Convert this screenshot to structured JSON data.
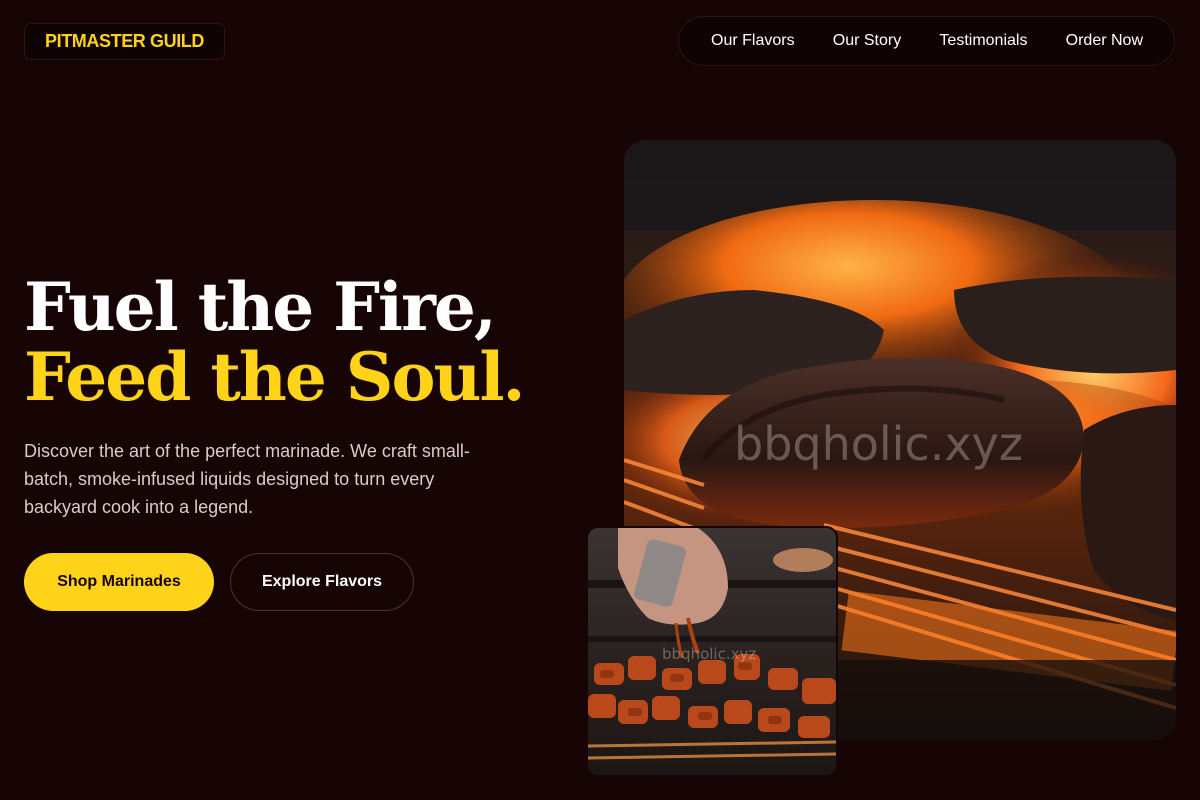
{
  "brand": {
    "logo_text": "PITMASTER GUILD",
    "accent_color": "#ffd31a",
    "background_color": "#170404"
  },
  "nav": {
    "items": [
      {
        "label": "Our Flavors"
      },
      {
        "label": "Our Story"
      },
      {
        "label": "Testimonials"
      },
      {
        "label": "Order Now"
      }
    ]
  },
  "hero": {
    "headline_line1": "Fuel the Fire,",
    "headline_line2": "Feed the Soul.",
    "subtext": "Discover the art of the perfect marinade. We craft small-batch, smoke-infused liquids designed to turn every backyard cook into a legend.",
    "primary_button": "Shop Marinades",
    "secondary_button": "Explore Flavors"
  },
  "images": {
    "main_watermark": "bbqholic.xyz",
    "thumb_watermark": "bbqholic.xyz"
  }
}
